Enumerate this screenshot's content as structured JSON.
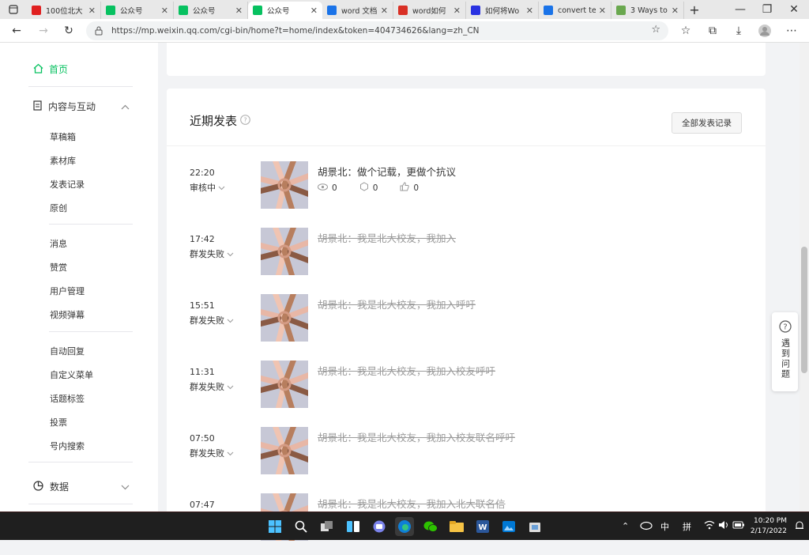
{
  "browser": {
    "tabs": [
      {
        "label": "100位北大",
        "icon": "site-logo-red",
        "color": "#e02020",
        "active": false
      },
      {
        "label": "公众号",
        "icon": "wechat-official-icon",
        "color": "#07c160",
        "active": false
      },
      {
        "label": "公众号",
        "icon": "wechat-official-icon",
        "color": "#07c160",
        "active": false
      },
      {
        "label": "公众号",
        "icon": "wechat-official-icon",
        "color": "#07c160",
        "active": true
      },
      {
        "label": "word 文档",
        "icon": "bing-icon",
        "color": "#1a73e8",
        "active": false
      },
      {
        "label": "word如何",
        "icon": "site-logo-red",
        "color": "#d93025",
        "active": false
      },
      {
        "label": "如何将Wo",
        "icon": "baidu-icon",
        "color": "#2932e1",
        "active": false
      },
      {
        "label": "convert te",
        "icon": "bing-icon",
        "color": "#1a73e8",
        "active": false
      },
      {
        "label": "3 Ways to",
        "icon": "site-logo-green",
        "color": "#6aa84f",
        "active": false
      }
    ],
    "new_tab": "+",
    "url": "https://mp.weixin.qq.com/cgi-bin/home?t=home/index&token=404734626&lang=zh_CN"
  },
  "sidebar": {
    "home": "首页",
    "content_section": "内容与互动",
    "content_items": [
      "草稿箱",
      "素材库",
      "发表记录",
      "原创"
    ],
    "interaction_items": [
      "消息",
      "赞赏",
      "用户管理",
      "视频弹幕"
    ],
    "feature_items": [
      "自动回复",
      "自定义菜单",
      "话题标签",
      "投票",
      "号内搜索"
    ],
    "data_section": "数据"
  },
  "recent": {
    "title": "近期发表",
    "all_records_button": "全部发表记录",
    "posts": [
      {
        "time": "22:20",
        "status": "审核中",
        "title": "胡景北：做个记载，更做个抗议",
        "failed": false,
        "views": "0",
        "shares": "0",
        "likes": "0"
      },
      {
        "time": "17:42",
        "status": "群发失败",
        "title": "胡景北：我是北大校友，我加入",
        "failed": true
      },
      {
        "time": "15:51",
        "status": "群发失败",
        "title": "胡景北：我是北大校友，我加入呼吁",
        "failed": true
      },
      {
        "time": "11:31",
        "status": "群发失败",
        "title": "胡景北：我是北大校友，我加入校友呼吁",
        "failed": true
      },
      {
        "time": "07:50",
        "status": "群发失败",
        "title": "胡景北：我是北大校友，我加入校友联名呼吁",
        "failed": true
      },
      {
        "time": "07:47",
        "status": "",
        "title": "胡景北：我是北大校友，我加入北大联名信",
        "failed": true
      }
    ]
  },
  "help_widget": {
    "label": "遇到问题",
    "icon": "question-icon"
  },
  "taskbar": {
    "ime_lang": "中",
    "ime_mode": "拼",
    "time": "10:20 PM",
    "date": "2/17/2022"
  },
  "colors": {
    "accent": "#07c160",
    "taskbar": "#1f1f1f"
  }
}
